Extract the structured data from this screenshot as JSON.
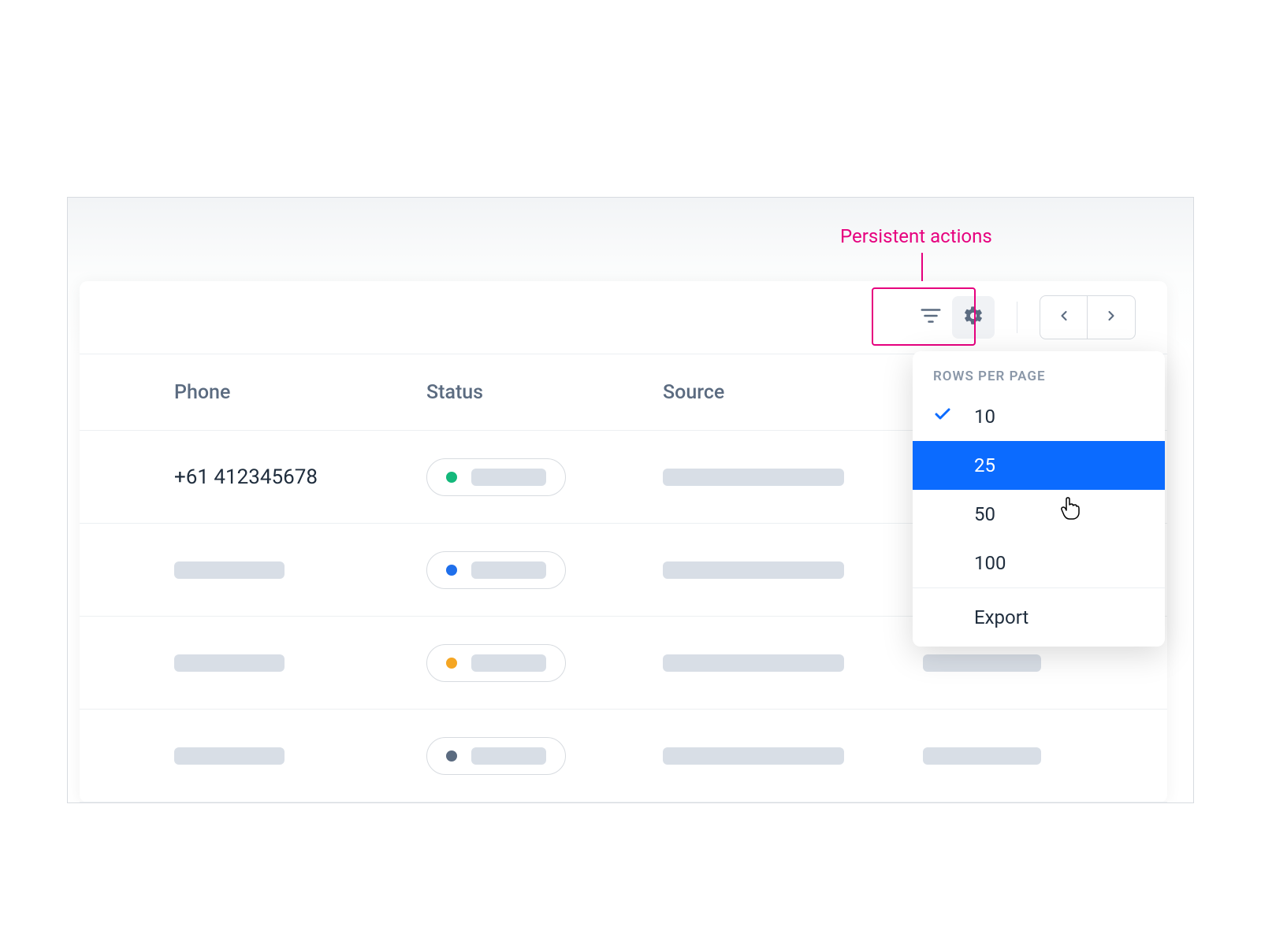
{
  "annotation": {
    "label": "Persistent actions",
    "color": "#e6007e"
  },
  "toolbar": {
    "icons": {
      "filter": "filter-icon",
      "settings": "gear-icon"
    }
  },
  "columns": {
    "phone": "Phone",
    "status": "Status",
    "source": "Source"
  },
  "rows": [
    {
      "phone": "+61 412345678",
      "status_color": "green"
    },
    {
      "phone": "",
      "status_color": "blue"
    },
    {
      "phone": "",
      "status_color": "orange"
    },
    {
      "phone": "",
      "status_color": "dark"
    }
  ],
  "menu": {
    "section_label": "Rows per page",
    "options": [
      {
        "value": "10",
        "checked": true,
        "selected": false
      },
      {
        "value": "25",
        "checked": false,
        "selected": true
      },
      {
        "value": "50",
        "checked": false,
        "selected": false
      },
      {
        "value": "100",
        "checked": false,
        "selected": false
      }
    ],
    "export_label": "Export"
  },
  "colors": {
    "accent_pink": "#e6007e",
    "accent_blue": "#0b6bff"
  }
}
